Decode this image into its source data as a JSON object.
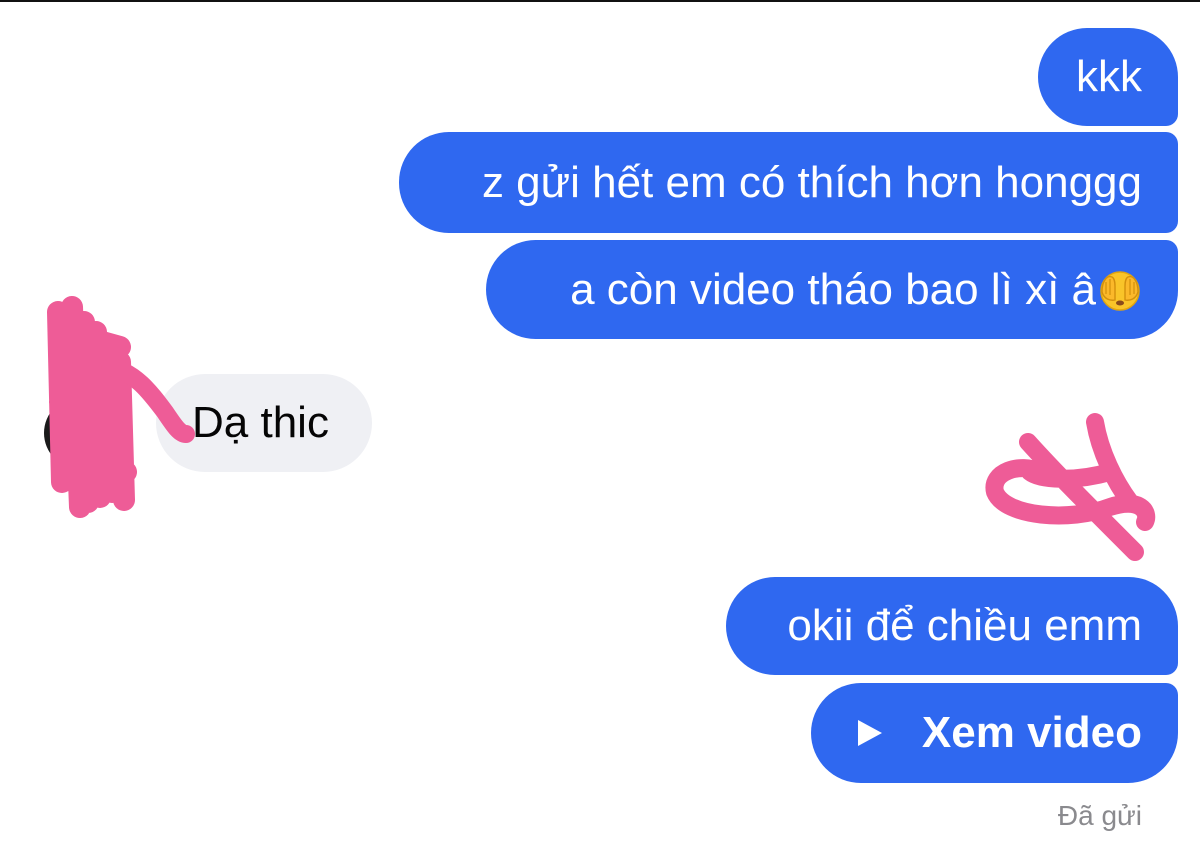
{
  "messages": {
    "outgoing_1": "kkk",
    "outgoing_2": "z gửi hết em có thích hơn honggg",
    "outgoing_3": "a còn video tháo bao lì xì â",
    "outgoing_3_emoji": "face-with-hand-over-eyes-emoji",
    "incoming_1": "Dạ thic",
    "outgoing_4": "okii để chiều emm",
    "video_button_label": "Xem video"
  },
  "status": {
    "text": "Đã gửi"
  },
  "colors": {
    "outgoing_bubble": "#2f68f0",
    "incoming_bubble": "#eff0f4",
    "redaction_scribble": "#ee5c97",
    "status_text": "#8a8a8e"
  },
  "icons": {
    "play": "play-icon",
    "avatar": "avatar"
  }
}
